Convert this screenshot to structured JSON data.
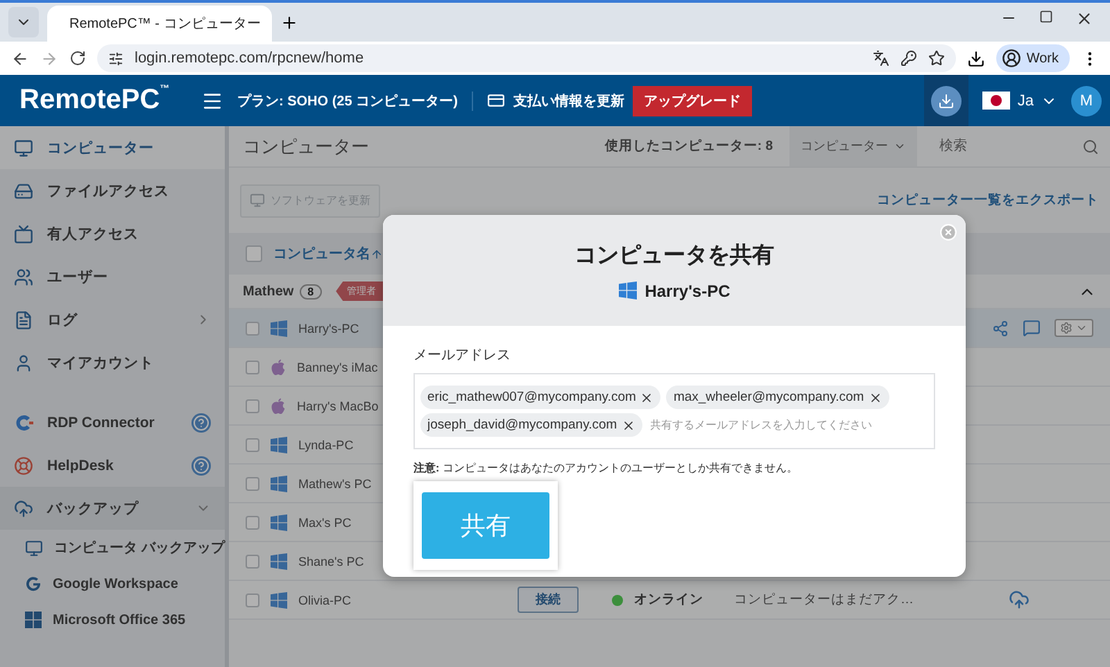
{
  "browser": {
    "tab_title": "RemotePC™ - コンピューター",
    "url": "login.remotepc.com/rpcnew/home",
    "profile": "Work"
  },
  "header": {
    "logo": "RemotePC",
    "logo_mark": "™",
    "plan": "プラン: SOHO (25 コンピューター)",
    "billing": "支払い情報を更新",
    "upgrade": "アップグレード",
    "language": "Ja",
    "avatar": "M"
  },
  "sidebar": {
    "sections": [
      [
        {
          "label": "コンピューター",
          "kind": "link",
          "selected": true
        },
        {
          "label": "ファイルアクセス",
          "kind": "link",
          "selected": false
        },
        {
          "label": "有人アクセス",
          "kind": "link",
          "selected": false
        },
        {
          "label": "ユーザー",
          "kind": "link",
          "selected": false
        },
        {
          "label": "ログ",
          "kind": "submenu",
          "selected": false,
          "expanded": false
        },
        {
          "label": "マイアカウント",
          "kind": "link",
          "selected": false
        }
      ],
      [
        {
          "label": "RDP Connector",
          "kind": "help",
          "selected": false
        },
        {
          "label": "HelpDesk",
          "kind": "help",
          "selected": false
        },
        {
          "label": "バックアップ",
          "kind": "submenu",
          "selected": false,
          "expanded": true,
          "children": [
            {
              "label": "コンピュータ バックアップ"
            },
            {
              "label": "Google Workspace"
            },
            {
              "label": "Microsoft Office 365"
            }
          ]
        }
      ]
    ]
  },
  "main": {
    "title": "コンピューター",
    "usage": "使用したコンピューター: 8",
    "filter": "コンピューター",
    "search_placeholder": "検索",
    "update_button": {
      "label": "ソフトウェアを更新",
      "disabled": true
    },
    "export_link": "コンピューター一覧をエクスポート",
    "table": {
      "select_all": {
        "checked": false
      },
      "column": "コンピュータ名",
      "group": {
        "name": "Mathew",
        "count": "8",
        "role": "管理者",
        "expanded": true
      },
      "rows": [
        {
          "name": "Harry's-PC",
          "kind": "windows",
          "selected": true,
          "checked": false
        },
        {
          "name": "Banney's iMac",
          "kind": "mac",
          "selected": false,
          "checked": false
        },
        {
          "name": "Harry's MacBo",
          "kind": "mac",
          "selected": false,
          "checked": false
        },
        {
          "name": "Lynda-PC",
          "kind": "windows",
          "selected": false,
          "checked": false
        },
        {
          "name": "Mathew's PC",
          "kind": "windows",
          "selected": false,
          "checked": false
        },
        {
          "name": "Max's PC",
          "kind": "windows",
          "selected": false,
          "checked": false
        },
        {
          "name": "Shane's PC",
          "kind": "windows",
          "selected": false,
          "checked": false
        },
        {
          "name": "Olivia-PC",
          "kind": "windows",
          "selected": false,
          "checked": false,
          "connect": "接続",
          "status": "オンライン",
          "color": "#3c8f3c",
          "note": "コンピューターはまだアク…"
        }
      ]
    }
  },
  "modal": {
    "title": "コンピュータを共有",
    "computer": "Harry's-PC",
    "email_label": "メールアドレス",
    "emails": [
      "eric_mathew007@mycompany.com",
      "max_wheeler@mycompany.com",
      "joseph_david@mycompany.com"
    ],
    "placeholder": "共有するメールアドレスを入力してください",
    "note": "**注意:** コンピュータはあなたのアカウントのユーザーとしか共有できません。",
    "button": "共有"
  }
}
